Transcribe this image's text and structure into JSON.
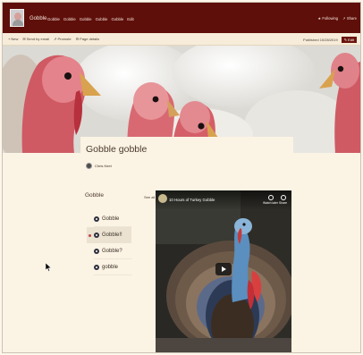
{
  "suite": {
    "site_title": "Gobble",
    "nav": [
      "Gobble",
      "Gobble",
      "Gobble",
      "Gobble",
      "Gobble",
      "Edit"
    ],
    "following_label": "Following",
    "share_label": "Share",
    "edit_label": "Edit"
  },
  "commandbar": {
    "new_label": "New",
    "send_label": "Send by email",
    "promote_label": "Promote",
    "details_label": "Page details",
    "published_text": "Published 10/28/2019",
    "edit_label": "Edit"
  },
  "page": {
    "title": "Gobble gobble",
    "author": "Chris Keet"
  },
  "navpart": {
    "title": "Gobble",
    "see_all": "See all",
    "items": [
      {
        "label": "Gobble"
      },
      {
        "label": "Gobble!!"
      },
      {
        "label": "Gobble?"
      },
      {
        "label": "gobble"
      }
    ],
    "selected_index": 1
  },
  "video": {
    "title": "10 Hours of Turkey Gobble",
    "watch_later": "Watch later",
    "share": "Share"
  },
  "colors": {
    "suite_bar": "#5e0f0a",
    "accent": "#7d1d16",
    "background": "#fbf3e4"
  }
}
